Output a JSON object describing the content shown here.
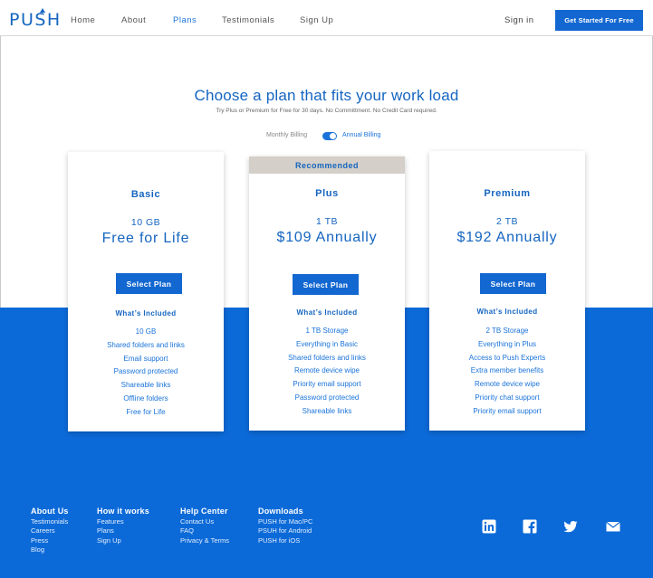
{
  "header": {
    "logo": "PUSH",
    "nav": [
      "Home",
      "About",
      "Plans",
      "Testimonials",
      "Sign Up"
    ],
    "active_nav": "Plans",
    "signin": "Sign in",
    "cta": "Get Started For Free"
  },
  "hero": {
    "title": "Choose a plan that fits your work load",
    "subtitle": "Try Plus or Premium for Free for 30 days. No Committment. No Credit Card required."
  },
  "billing": {
    "monthly": "Monthly Billing",
    "annual": "Annual Billing",
    "annual_selected": true
  },
  "plans": [
    {
      "name": "Basic",
      "storage": "10 GB",
      "price": "Free for Life",
      "button": "Select Plan",
      "included_label": "What’s Included",
      "features": [
        "10 GB",
        "Shared folders and links",
        "Email support",
        "Password protected",
        "Shareable links",
        "Offline folders",
        "Free for Life"
      ]
    },
    {
      "name": "Plus",
      "badge": "Recommended",
      "storage": "1 TB",
      "price": "$109 Annually",
      "button": "Select Plan",
      "included_label": "What’s Included",
      "features": [
        "1 TB Storage",
        "Everything in Basic",
        "Shared folders and links",
        "Remote device wipe",
        "Priority email support",
        "Password protected",
        "Shareable links"
      ]
    },
    {
      "name": "Premium",
      "storage": "2 TB",
      "price": "$192 Annually",
      "button": "Select Plan",
      "included_label": "What’s Included",
      "features": [
        "2 TB Storage",
        "Everything in Plus",
        "Access to Push Experts",
        "Extra member benefits",
        "Remote device wipe",
        "Priority chat support",
        "Priority email support"
      ]
    }
  ],
  "footer": {
    "columns": [
      {
        "heading": "About Us",
        "links": [
          "Testimonials",
          "Careers",
          "Press",
          "Blog"
        ]
      },
      {
        "heading": "How it works",
        "links": [
          "Features",
          "Plans",
          "Sign Up"
        ]
      },
      {
        "heading": "Help Center",
        "links": [
          "Contact Us",
          "FAQ",
          "Privacy & Terms"
        ]
      },
      {
        "heading": "Downloads",
        "links": [
          "PUSH for Mac/PC",
          "PSUH for Android",
          "PUSH for iOS"
        ]
      }
    ],
    "social": [
      "linkedin-icon",
      "facebook-icon",
      "twitter-icon",
      "email-icon"
    ]
  },
  "colors": {
    "brand_blue": "#1367d1",
    "band_blue": "#0c6ad8",
    "recommended_bg": "#d4cfc8"
  }
}
